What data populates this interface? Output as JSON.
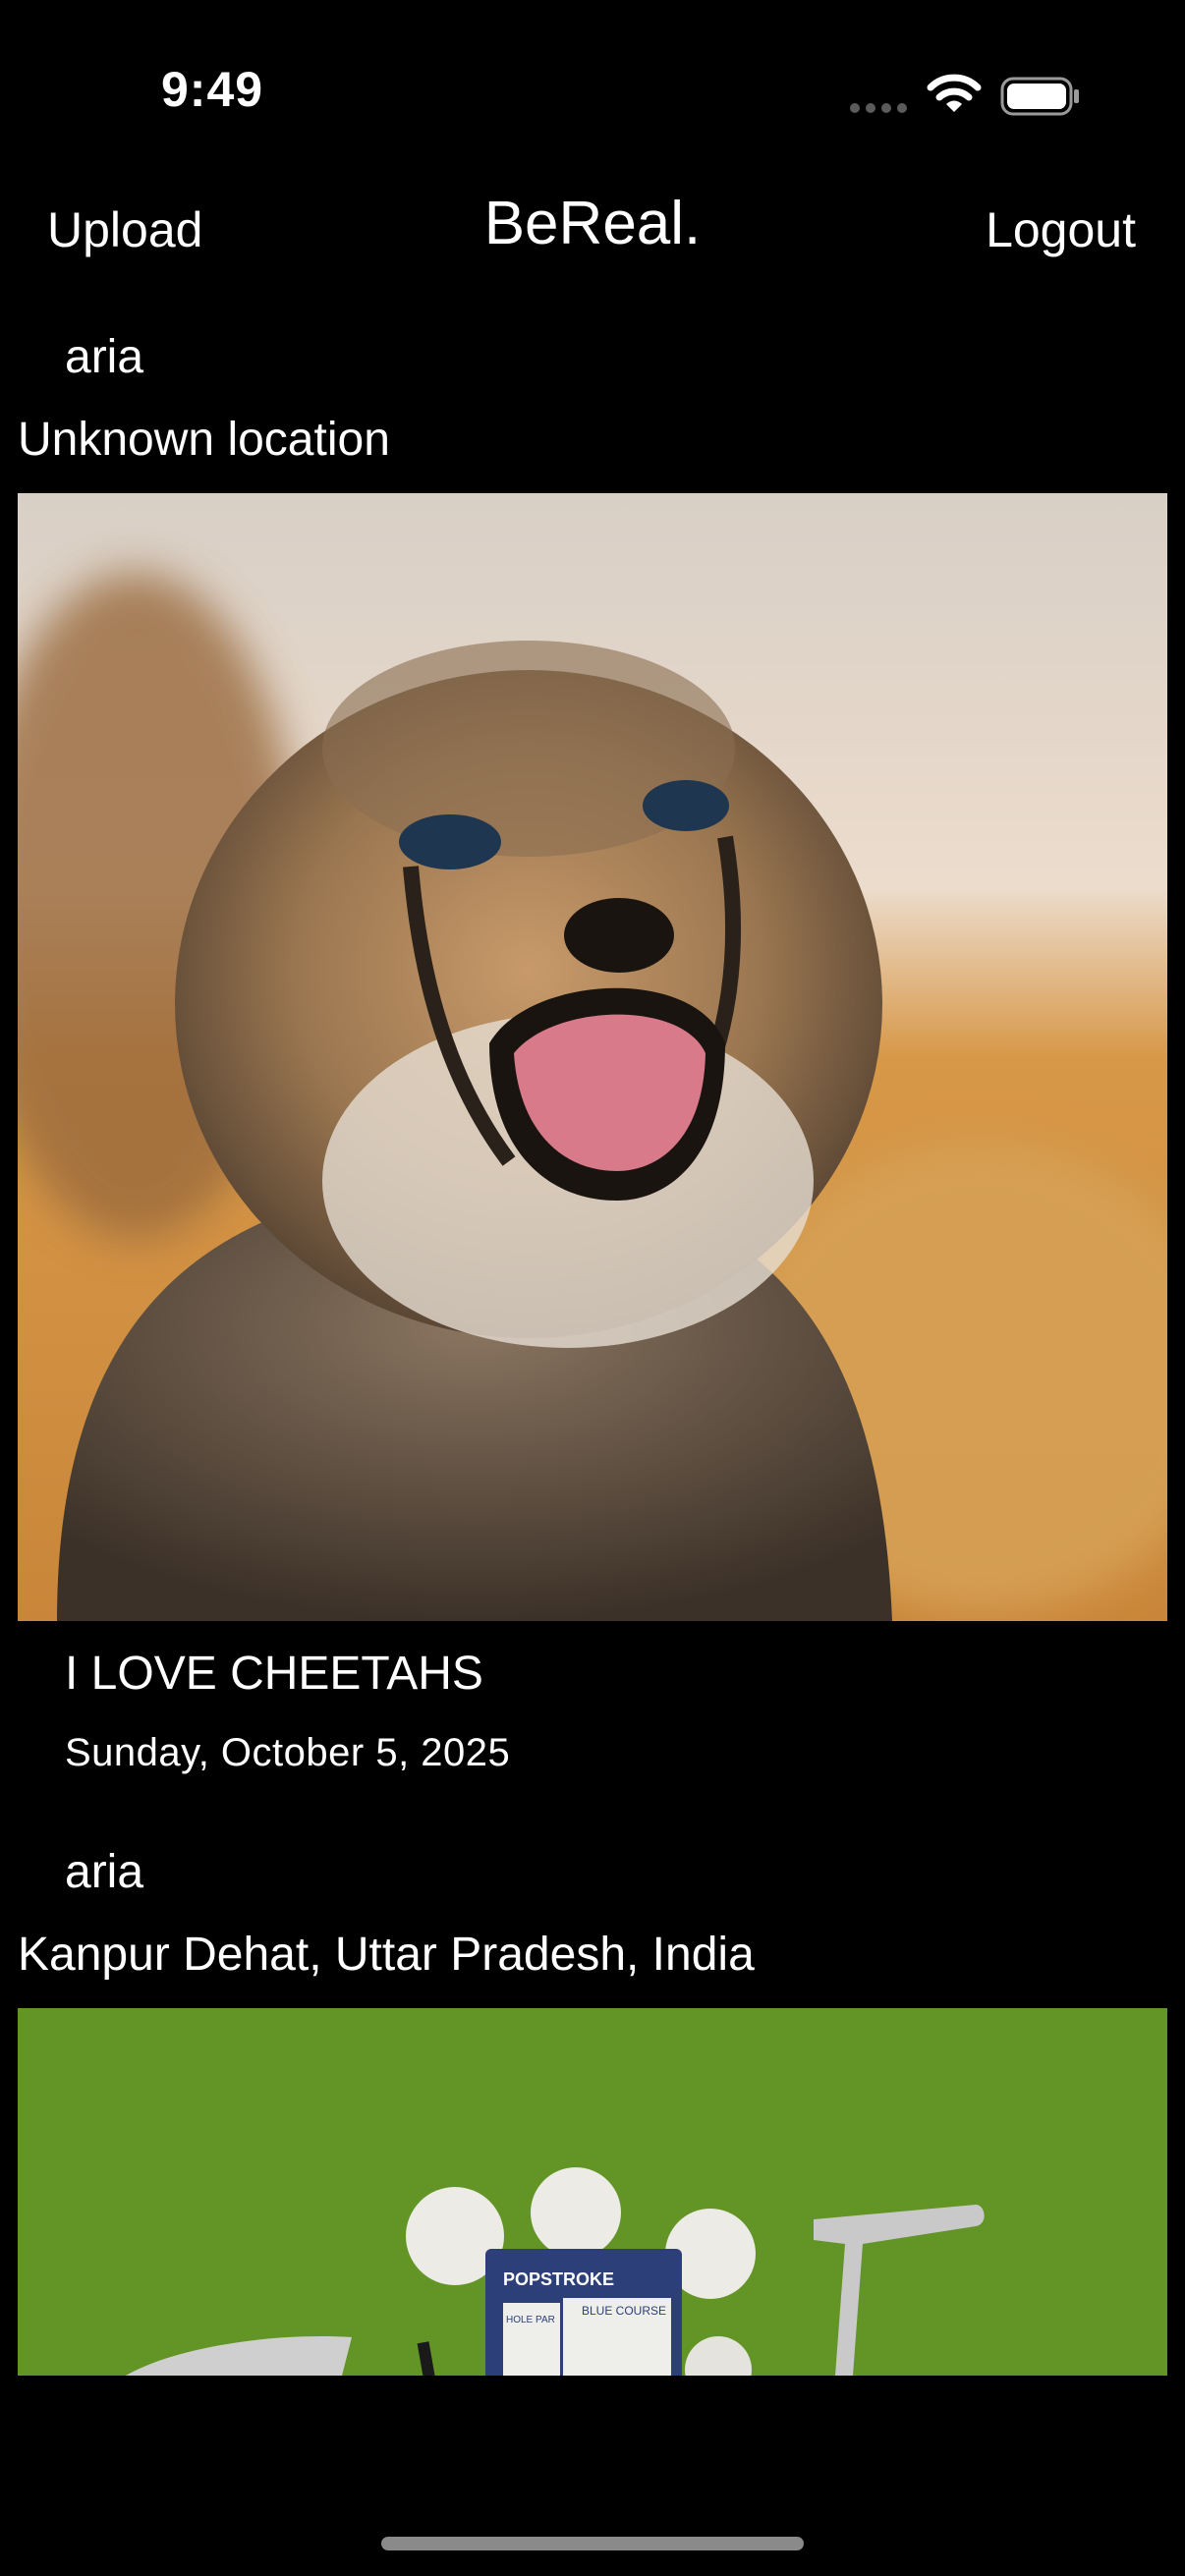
{
  "status_bar": {
    "time": "9:49",
    "icons": [
      "cellular-signal-icon",
      "wifi-icon",
      "battery-icon"
    ]
  },
  "nav": {
    "upload_label": "Upload",
    "title": "BeReal.",
    "logout_label": "Logout"
  },
  "posts": [
    {
      "username": "aria",
      "location": "Unknown location",
      "image_subject": "cheetah cub",
      "caption": "I LOVE CHEETAHS",
      "date": "Sunday, October 5, 2025"
    },
    {
      "username": "aria",
      "location": "Kanpur Dehat, Uttar Pradesh, India",
      "image_subject": "golf balls, scorecard and putter on turf",
      "image_text": {
        "brand": "POPSTROKE",
        "card_header": "BLUE COURSE",
        "card_columns": "HOLE PAR"
      }
    }
  ],
  "colors": {
    "background": "#000000",
    "text": "#ffffff",
    "turf": "#5f8f24",
    "scorecard": "#2c3f78"
  }
}
